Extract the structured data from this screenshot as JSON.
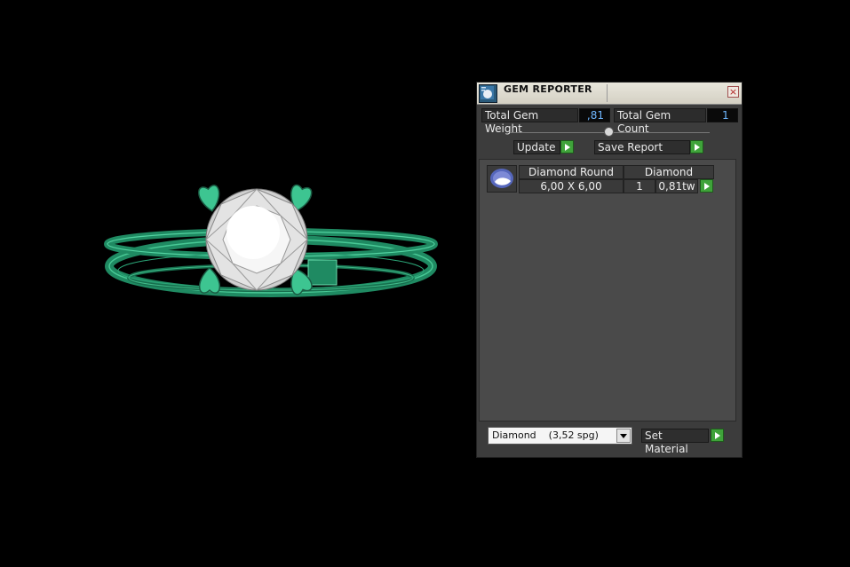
{
  "panel": {
    "title": "GEM REPORTER",
    "close_glyph": "×",
    "total_weight_label": "Total Gem Weight",
    "total_weight_value": ",81",
    "total_count_label": "Total Gem Count",
    "total_count_value": "1",
    "update_label": "Update",
    "save_label": "Save Report",
    "set_material_label": "Set Material",
    "material_value": "Diamond    (3,52 spg)"
  },
  "gems": [
    {
      "name": "Diamond Round",
      "material": "Diamond",
      "size": "6,00 X 6,00",
      "count": "1",
      "weight": "0,81tw"
    }
  ],
  "icons": {
    "app": "gem-reporter-icon",
    "close": "close-icon",
    "go": "play-arrow-icon",
    "thumb": "round-gem-icon",
    "dropdown": "chevron-down-icon"
  },
  "colors": {
    "value_text": "#6fb7ff",
    "go_button": "#3fa33a",
    "ring_green": "#2a9e74"
  }
}
